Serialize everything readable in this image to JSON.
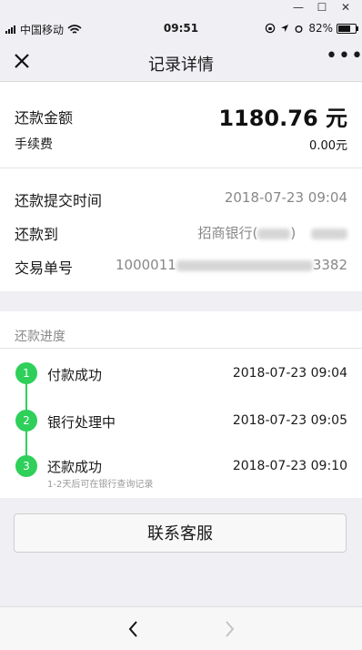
{
  "window_controls": {
    "minimize": "—",
    "maximize": "☐",
    "close": "✕"
  },
  "status_bar": {
    "carrier": "中国移动",
    "time": "09:51",
    "battery": "82%",
    "battery_level": 0.82
  },
  "nav": {
    "title": "记录详情",
    "more": "•••"
  },
  "summary": {
    "amount_label": "还款金额",
    "amount_value": "1180.76 元",
    "fee_label": "手续费",
    "fee_value": "0.00元"
  },
  "details": {
    "time_label": "还款提交时间",
    "time_value": "2018-07-23 09:04",
    "to_label": "还款到",
    "to_value_prefix": "招商银行(",
    "to_value_suffix": ")",
    "order_label": "交易单号",
    "order_prefix": "1000011",
    "order_suffix": "3382"
  },
  "progress": {
    "title": "还款进度",
    "steps": [
      {
        "num": "1",
        "label": "付款成功",
        "time": "2018-07-23 09:04"
      },
      {
        "num": "2",
        "label": "银行处理中",
        "time": "2018-07-23 09:05"
      },
      {
        "num": "3",
        "label": "还款成功",
        "time": "2018-07-23 09:10",
        "sub": "1-2天后可在银行查询记录"
      }
    ]
  },
  "contact_button": "联系客服",
  "colors": {
    "accent": "#2ed05a",
    "background": "#efeff4"
  }
}
